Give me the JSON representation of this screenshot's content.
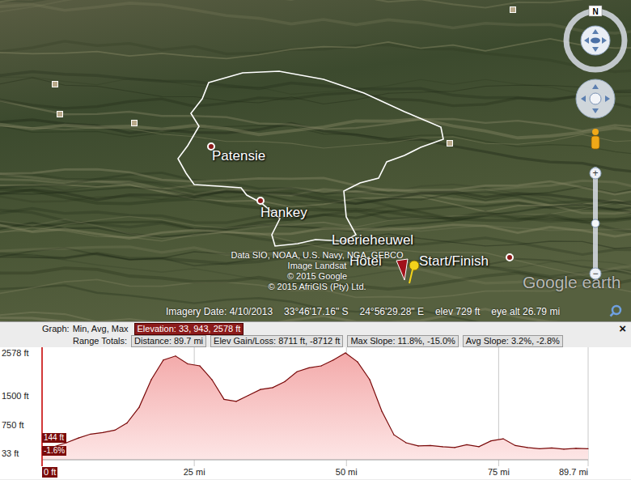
{
  "map": {
    "places": [
      {
        "name": "Patensie",
        "kind": "dot"
      },
      {
        "name": "Hankey",
        "kind": "dot"
      },
      {
        "name": "Loerieheuwel",
        "kind": "label"
      },
      {
        "name": "Hotel",
        "kind": "label"
      },
      {
        "name": "Start/Finish",
        "kind": "label"
      }
    ],
    "attribution": [
      "Data SIO, NOAA, U.S. Navy, NGA, GEBCO",
      "Image Landsat",
      "© 2015 Google",
      "© 2015 AfriGIS (Pty) Ltd."
    ],
    "logo": "Google earth",
    "compass": "N",
    "zoom_in": "+",
    "zoom_out": "−",
    "zoom_level": 0.5
  },
  "status_bar": {
    "imagery_date": "Imagery Date: 4/10/2013",
    "latitude": "33°46'17.16\" S",
    "longitude": "24°56'29.28\" E",
    "elev_label": "elev",
    "elev": "729 ft",
    "eye_alt": "eye alt 26.79 mi"
  },
  "graph": {
    "label": "Graph:",
    "modes": "Min, Avg, Max",
    "elevation": {
      "text": "Elevation: 33, 943, 2578 ft",
      "selected": true
    },
    "range_label": "Range Totals:",
    "totals": [
      "Distance: 89.7 mi",
      "Elev Gain/Loss: 8711 ft, -8712 ft",
      "Max Slope: 11.8%, -15.0%",
      "Avg Slope: 3.2%, -2.8%"
    ],
    "close": "×"
  },
  "chart": {
    "y_min": 33,
    "y_max": 2578,
    "x_max": 89.7,
    "y_ticks": [
      {
        "label": "2578 ft",
        "value": 2578
      },
      {
        "label": "1500 ft",
        "value": 1500
      },
      {
        "label": "750 ft",
        "value": 750
      },
      {
        "label": "33 ft",
        "value": 33
      }
    ],
    "x_ticks": [
      {
        "label": "0 ft",
        "value": 0
      },
      {
        "label": "25 mi",
        "value": 25
      },
      {
        "label": "50 mi",
        "value": 50
      },
      {
        "label": "75 mi",
        "value": 75
      },
      {
        "label": "89.7 mi",
        "value": 89.7
      }
    ],
    "series": [
      {
        "name": "Elevation",
        "values": [
          144,
          200,
          300,
          420,
          520,
          560,
          620,
          800,
          1200,
          1900,
          2400,
          2500,
          2300,
          2250,
          1900,
          1400,
          1350,
          1500,
          1650,
          1700,
          1850,
          2100,
          2200,
          2250,
          2400,
          2578,
          2350,
          1900,
          1100,
          500,
          300,
          220,
          230,
          200,
          180,
          250,
          200,
          350,
          400,
          230,
          180,
          150,
          170,
          140,
          160,
          150
        ]
      }
    ],
    "cursor": {
      "distance": 0,
      "value": 144,
      "elevation_label": "144 ft",
      "slope_label": "-1.6%"
    }
  }
}
